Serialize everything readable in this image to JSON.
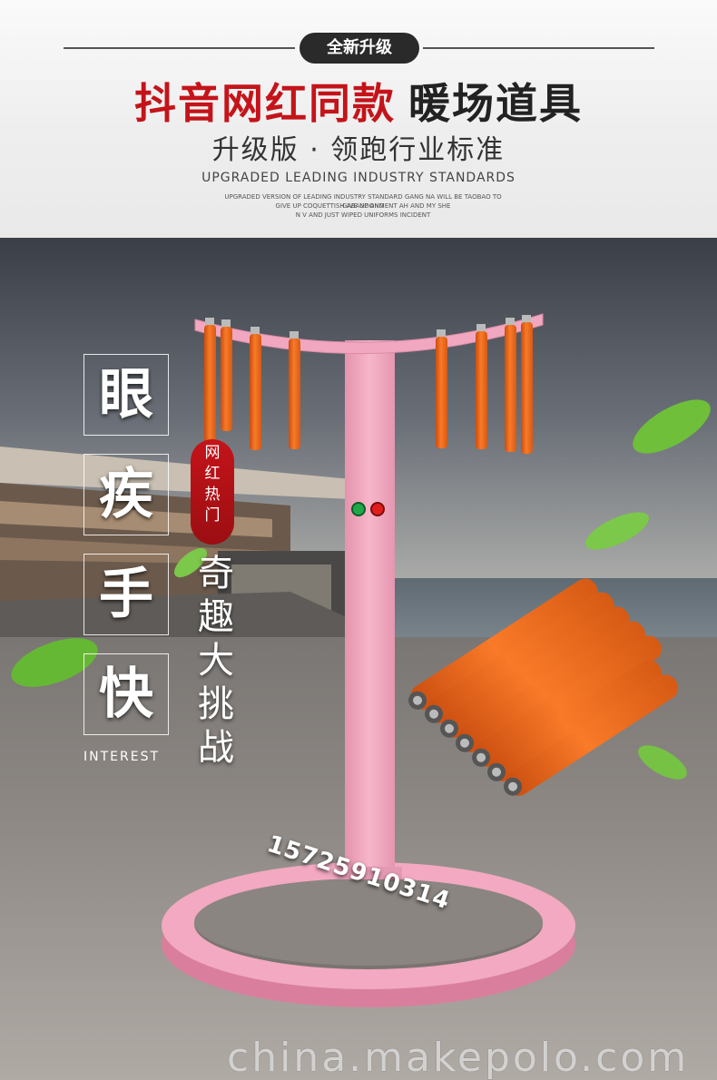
{
  "header": {
    "badge": "全新升级",
    "title_red": "抖音网红同款",
    "title_dark": "暖场道具",
    "subtitle": "升级版 · 领跑行业标准",
    "english": "UPGRADED LEADING INDUSTRY STANDARDS",
    "fine_print": [
      "UPGRADED VERSION OF LEADING INDUSTRY STANDARD GANG NA WILL BE TAOBAO TO GIVE UP AND",
      "GIVE UP COQUETTISH ABANDONMENT AH AND MY SHE",
      "N V AND JUST WIPED UNIFORMS INCIDENT"
    ]
  },
  "left_column": [
    "眼",
    "疾",
    "手",
    "快"
  ],
  "interest": "INTEREST",
  "tag_text": [
    "网",
    "红",
    "热",
    "门"
  ],
  "vertical_slogan": [
    "奇",
    "趣",
    "大",
    "挑",
    "战"
  ],
  "phone": "15725910314",
  "watermark": "china.makepolo.com",
  "colors": {
    "stand": "#f0a8bf",
    "stick": "#f26a1b",
    "red_accent": "#c4141a"
  },
  "icons": [
    "green-light-icon",
    "red-light-icon",
    "leaf-icon"
  ]
}
